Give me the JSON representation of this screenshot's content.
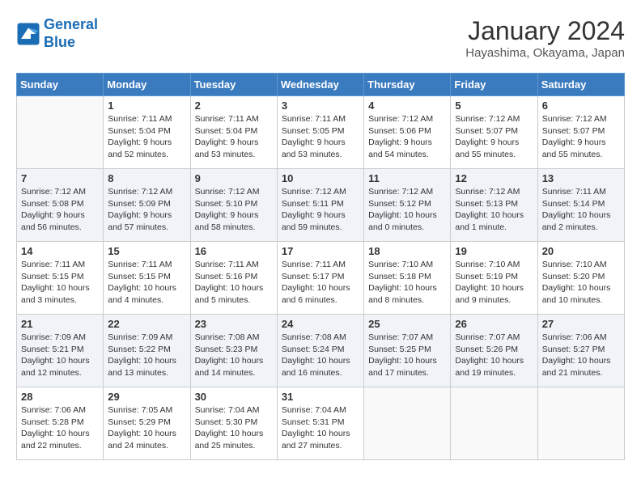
{
  "app": {
    "logo_line1": "General",
    "logo_line2": "Blue"
  },
  "calendar": {
    "month_title": "January 2024",
    "location": "Hayashima, Okayama, Japan",
    "weekdays": [
      "Sunday",
      "Monday",
      "Tuesday",
      "Wednesday",
      "Thursday",
      "Friday",
      "Saturday"
    ],
    "weeks": [
      [
        {
          "day": "",
          "sunrise": "",
          "sunset": "",
          "daylight": "",
          "empty": true
        },
        {
          "day": "1",
          "sunrise": "Sunrise: 7:11 AM",
          "sunset": "Sunset: 5:04 PM",
          "daylight": "Daylight: 9 hours and 52 minutes."
        },
        {
          "day": "2",
          "sunrise": "Sunrise: 7:11 AM",
          "sunset": "Sunset: 5:04 PM",
          "daylight": "Daylight: 9 hours and 53 minutes."
        },
        {
          "day": "3",
          "sunrise": "Sunrise: 7:11 AM",
          "sunset": "Sunset: 5:05 PM",
          "daylight": "Daylight: 9 hours and 53 minutes."
        },
        {
          "day": "4",
          "sunrise": "Sunrise: 7:12 AM",
          "sunset": "Sunset: 5:06 PM",
          "daylight": "Daylight: 9 hours and 54 minutes."
        },
        {
          "day": "5",
          "sunrise": "Sunrise: 7:12 AM",
          "sunset": "Sunset: 5:07 PM",
          "daylight": "Daylight: 9 hours and 55 minutes."
        },
        {
          "day": "6",
          "sunrise": "Sunrise: 7:12 AM",
          "sunset": "Sunset: 5:07 PM",
          "daylight": "Daylight: 9 hours and 55 minutes."
        }
      ],
      [
        {
          "day": "7",
          "sunrise": "Sunrise: 7:12 AM",
          "sunset": "Sunset: 5:08 PM",
          "daylight": "Daylight: 9 hours and 56 minutes."
        },
        {
          "day": "8",
          "sunrise": "Sunrise: 7:12 AM",
          "sunset": "Sunset: 5:09 PM",
          "daylight": "Daylight: 9 hours and 57 minutes."
        },
        {
          "day": "9",
          "sunrise": "Sunrise: 7:12 AM",
          "sunset": "Sunset: 5:10 PM",
          "daylight": "Daylight: 9 hours and 58 minutes."
        },
        {
          "day": "10",
          "sunrise": "Sunrise: 7:12 AM",
          "sunset": "Sunset: 5:11 PM",
          "daylight": "Daylight: 9 hours and 59 minutes."
        },
        {
          "day": "11",
          "sunrise": "Sunrise: 7:12 AM",
          "sunset": "Sunset: 5:12 PM",
          "daylight": "Daylight: 10 hours and 0 minutes."
        },
        {
          "day": "12",
          "sunrise": "Sunrise: 7:12 AM",
          "sunset": "Sunset: 5:13 PM",
          "daylight": "Daylight: 10 hours and 1 minute."
        },
        {
          "day": "13",
          "sunrise": "Sunrise: 7:11 AM",
          "sunset": "Sunset: 5:14 PM",
          "daylight": "Daylight: 10 hours and 2 minutes."
        }
      ],
      [
        {
          "day": "14",
          "sunrise": "Sunrise: 7:11 AM",
          "sunset": "Sunset: 5:15 PM",
          "daylight": "Daylight: 10 hours and 3 minutes."
        },
        {
          "day": "15",
          "sunrise": "Sunrise: 7:11 AM",
          "sunset": "Sunset: 5:15 PM",
          "daylight": "Daylight: 10 hours and 4 minutes."
        },
        {
          "day": "16",
          "sunrise": "Sunrise: 7:11 AM",
          "sunset": "Sunset: 5:16 PM",
          "daylight": "Daylight: 10 hours and 5 minutes."
        },
        {
          "day": "17",
          "sunrise": "Sunrise: 7:11 AM",
          "sunset": "Sunset: 5:17 PM",
          "daylight": "Daylight: 10 hours and 6 minutes."
        },
        {
          "day": "18",
          "sunrise": "Sunrise: 7:10 AM",
          "sunset": "Sunset: 5:18 PM",
          "daylight": "Daylight: 10 hours and 8 minutes."
        },
        {
          "day": "19",
          "sunrise": "Sunrise: 7:10 AM",
          "sunset": "Sunset: 5:19 PM",
          "daylight": "Daylight: 10 hours and 9 minutes."
        },
        {
          "day": "20",
          "sunrise": "Sunrise: 7:10 AM",
          "sunset": "Sunset: 5:20 PM",
          "daylight": "Daylight: 10 hours and 10 minutes."
        }
      ],
      [
        {
          "day": "21",
          "sunrise": "Sunrise: 7:09 AM",
          "sunset": "Sunset: 5:21 PM",
          "daylight": "Daylight: 10 hours and 12 minutes."
        },
        {
          "day": "22",
          "sunrise": "Sunrise: 7:09 AM",
          "sunset": "Sunset: 5:22 PM",
          "daylight": "Daylight: 10 hours and 13 minutes."
        },
        {
          "day": "23",
          "sunrise": "Sunrise: 7:08 AM",
          "sunset": "Sunset: 5:23 PM",
          "daylight": "Daylight: 10 hours and 14 minutes."
        },
        {
          "day": "24",
          "sunrise": "Sunrise: 7:08 AM",
          "sunset": "Sunset: 5:24 PM",
          "daylight": "Daylight: 10 hours and 16 minutes."
        },
        {
          "day": "25",
          "sunrise": "Sunrise: 7:07 AM",
          "sunset": "Sunset: 5:25 PM",
          "daylight": "Daylight: 10 hours and 17 minutes."
        },
        {
          "day": "26",
          "sunrise": "Sunrise: 7:07 AM",
          "sunset": "Sunset: 5:26 PM",
          "daylight": "Daylight: 10 hours and 19 minutes."
        },
        {
          "day": "27",
          "sunrise": "Sunrise: 7:06 AM",
          "sunset": "Sunset: 5:27 PM",
          "daylight": "Daylight: 10 hours and 21 minutes."
        }
      ],
      [
        {
          "day": "28",
          "sunrise": "Sunrise: 7:06 AM",
          "sunset": "Sunset: 5:28 PM",
          "daylight": "Daylight: 10 hours and 22 minutes."
        },
        {
          "day": "29",
          "sunrise": "Sunrise: 7:05 AM",
          "sunset": "Sunset: 5:29 PM",
          "daylight": "Daylight: 10 hours and 24 minutes."
        },
        {
          "day": "30",
          "sunrise": "Sunrise: 7:04 AM",
          "sunset": "Sunset: 5:30 PM",
          "daylight": "Daylight: 10 hours and 25 minutes."
        },
        {
          "day": "31",
          "sunrise": "Sunrise: 7:04 AM",
          "sunset": "Sunset: 5:31 PM",
          "daylight": "Daylight: 10 hours and 27 minutes."
        },
        {
          "day": "",
          "sunrise": "",
          "sunset": "",
          "daylight": "",
          "empty": true
        },
        {
          "day": "",
          "sunrise": "",
          "sunset": "",
          "daylight": "",
          "empty": true
        },
        {
          "day": "",
          "sunrise": "",
          "sunset": "",
          "daylight": "",
          "empty": true
        }
      ]
    ]
  }
}
